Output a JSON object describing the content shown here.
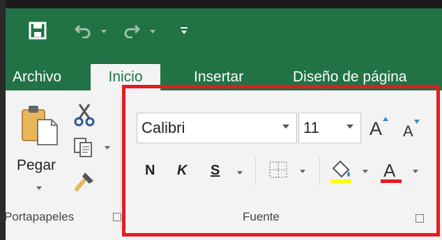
{
  "tabs": {
    "archivo": "Archivo",
    "inicio": "Inicio",
    "insertar": "Insertar",
    "diseno": "Diseño de página"
  },
  "clipboard": {
    "paste_label": "Pegar",
    "group_label": "Portapapeles"
  },
  "font_group": {
    "font_name": "Calibri",
    "font_size": "11",
    "bold": "N",
    "italic": "K",
    "underline": "S",
    "increase_size": "A",
    "decrease_size": "A",
    "font_color_glyph": "A",
    "group_label": "Fuente"
  },
  "colors": {
    "ribbon_green": "#217346",
    "highlight_yellow": "#ffff00",
    "font_red": "#e21c23",
    "callout_red": "#e21c23"
  }
}
